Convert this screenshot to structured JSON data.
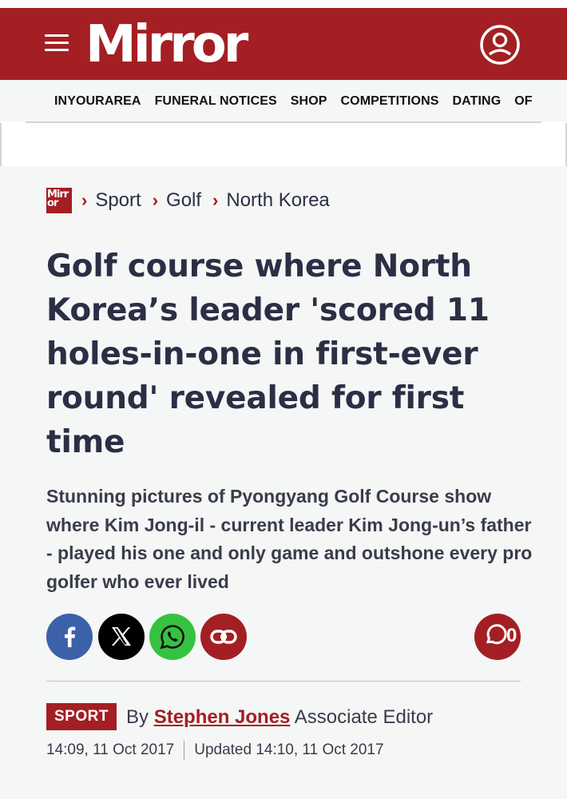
{
  "header": {
    "logo_text": "Mirror",
    "menu_icon": "hamburger-menu-icon",
    "account_icon": "user-account-icon",
    "brand_color": "#a31f23"
  },
  "nav": {
    "items": [
      "INYOURAREA",
      "FUNERAL NOTICES",
      "SHOP",
      "COMPETITIONS",
      "DATING",
      "OF"
    ]
  },
  "breadcrumb": {
    "logo_text": "Mirr or",
    "items": [
      "Sport",
      "Golf",
      "North Korea"
    ]
  },
  "article": {
    "headline": "Golf course where North Korea’s leader 'scored 11 holes-in-one in first-ever round' revealed for first time",
    "standfirst": "Stunning pictures of Pyongyang Golf Course show where Kim Jong-il - current leader Kim Jong-un’s father - played his one and only game and outshone every pro golfer who ever lived",
    "category_badge": "SPORT",
    "byline_prefix": "By",
    "author": "Stephen Jones",
    "author_role": "Associate Editor",
    "published": "14:09, 11 Oct 2017",
    "updated": "Updated 14:10, 11 Oct 2017"
  },
  "share": {
    "buttons": [
      {
        "name": "facebook",
        "icon": "facebook-icon",
        "color": "#3b62a8"
      },
      {
        "name": "x",
        "icon": "x-logo-icon",
        "color": "#000000"
      },
      {
        "name": "whatsapp",
        "icon": "whatsapp-icon",
        "color": "#35c241"
      },
      {
        "name": "copy-link",
        "icon": "link-icon",
        "color": "#a31f23"
      }
    ],
    "comment_count": "0",
    "comment_icon": "speech-bubble-icon"
  }
}
